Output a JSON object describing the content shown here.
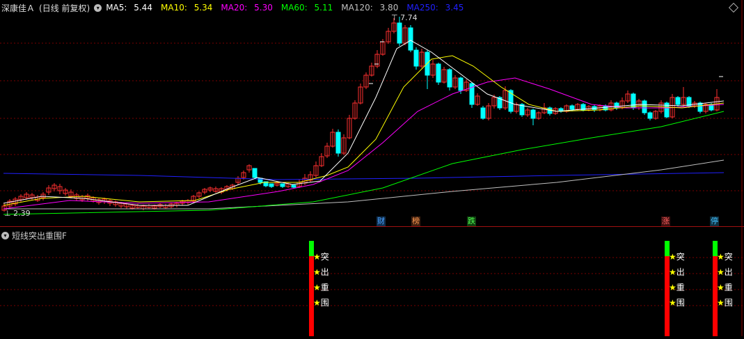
{
  "header": {
    "stock_name": "深康佳Ａ",
    "period": "(日线 前复权)",
    "ma": [
      {
        "label": "MA5:",
        "value": "5.44",
        "color": "#ffffff"
      },
      {
        "label": "MA10:",
        "value": "5.34",
        "color": "#ffff00"
      },
      {
        "label": "MA20:",
        "value": "5.30",
        "color": "#ff00ff"
      },
      {
        "label": "MA60:",
        "value": "5.11",
        "color": "#00ff00"
      },
      {
        "label": "MA120:",
        "value": "3.80",
        "color": "#c0c0c0"
      },
      {
        "label": "MA250:",
        "value": "3.45",
        "color": "#2020ff"
      }
    ]
  },
  "price_labels": {
    "high": "7.74",
    "low": "2.39"
  },
  "event_markers": [
    {
      "text": "财",
      "color": "#4aa0ff",
      "bg": "#103050"
    },
    {
      "text": "榜",
      "color": "#ff9a50",
      "bg": "#402010"
    },
    {
      "text": "跌",
      "color": "#50ff50",
      "bg": "#104010"
    },
    {
      "text": "涨",
      "color": "#ff6060",
      "bg": "#401010"
    },
    {
      "text": "停",
      "color": "#40c0ff",
      "bg": "#103040"
    }
  ],
  "indicator": {
    "name": "短线突出重围F",
    "star_labels": [
      "突",
      "出",
      "重",
      "围"
    ],
    "signal_count": 3
  },
  "colors": {
    "up": "#ff3030",
    "down": "#00ffff",
    "grid": "#7a0000",
    "signal_red": "#ff0000",
    "signal_green": "#00ff00",
    "star": "#ffff00"
  }
}
